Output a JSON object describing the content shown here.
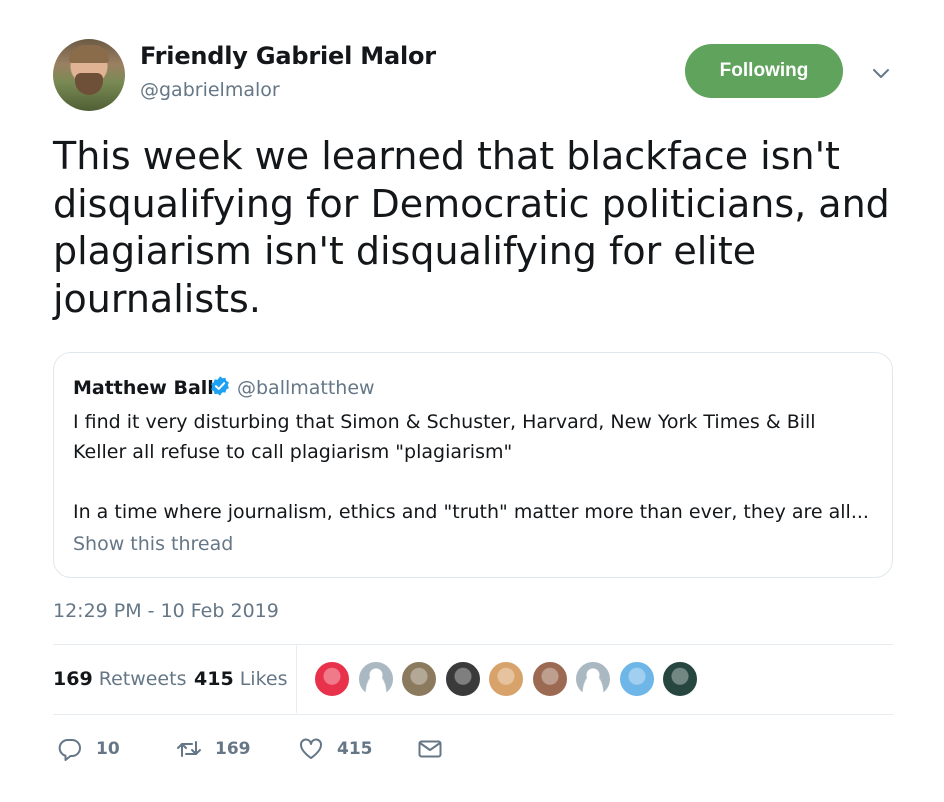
{
  "tweet": {
    "author": {
      "name": "Friendly Gabriel Malor",
      "handle": "@gabrielmalor",
      "avatar_icon": "user-avatar"
    },
    "follow_button_label": "Following",
    "follow_button_color": "#5fa35c",
    "text": "This week we learned that blackface isn't disqualifying for Democratic politicians, and plagiarism isn't disqualifying for elite journalists.",
    "quoted": {
      "name": "Matthew Ball",
      "verified": true,
      "verified_color": "#1da1f2",
      "handle": "@ballmatthew",
      "text_line1": "I find it very disturbing that Simon & Schuster, Harvard, New York Times & Bill Keller all refuse to call plagiarism \"plagiarism\"",
      "text_line2": "In a time where journalism, ethics and \"truth\" matter more than ever, they are all...",
      "show_thread_label": "Show this thread"
    },
    "timestamp": "12:29 PM - 10 Feb 2019",
    "stats": {
      "retweets_count": "169",
      "retweets_label": "Retweets",
      "likes_count": "415",
      "likes_label": "Likes"
    },
    "likers": [
      {
        "icon": "flower-avatar",
        "color": "#e8314b"
      },
      {
        "icon": "default-avatar",
        "color": "#aab8c2"
      },
      {
        "icon": "man-avatar",
        "color": "#8b7a5e"
      },
      {
        "icon": "dark-avatar",
        "color": "#3a3a3a"
      },
      {
        "icon": "woman-avatar",
        "color": "#d8a36a"
      },
      {
        "icon": "woman-avatar-2",
        "color": "#9c6a52"
      },
      {
        "icon": "default-avatar",
        "color": "#aab8c2"
      },
      {
        "icon": "map-avatar",
        "color": "#6fb6e8"
      },
      {
        "icon": "dark-avatar-2",
        "color": "#27463f"
      }
    ],
    "actions": {
      "reply_count": "10",
      "retweet_count": "169",
      "like_count": "415"
    }
  }
}
